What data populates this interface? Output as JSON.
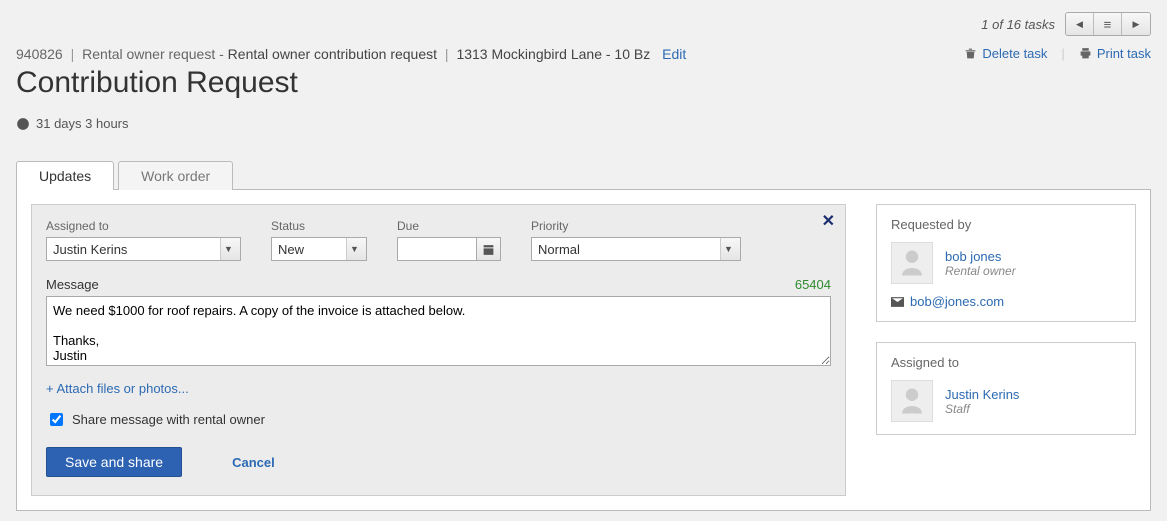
{
  "topbar": {
    "task_count": "1 of 16 tasks"
  },
  "breadcrumb": {
    "id": "940826",
    "type": "Rental owner request",
    "subtype": "Rental owner contribution request",
    "property": "1313 Mockingbird Lane - 10 Bz",
    "edit": "Edit"
  },
  "actions": {
    "delete": "Delete task",
    "print": "Print task"
  },
  "title": "Contribution Request",
  "age": "31 days 3 hours",
  "tabs": {
    "updates": "Updates",
    "work_order": "Work order"
  },
  "form": {
    "assigned_label": "Assigned to",
    "assigned_value": "Justin Kerins",
    "status_label": "Status",
    "status_value": "New",
    "due_label": "Due",
    "due_value": "",
    "priority_label": "Priority",
    "priority_value": "Normal",
    "message_label": "Message",
    "char_count": "65404",
    "message_value": "We need $1000 for roof repairs. A copy of the invoice is attached below.\n\nThanks,\nJustin",
    "attach": "+ Attach files or photos...",
    "share_label": "Share message with rental owner",
    "save": "Save and share",
    "cancel": "Cancel"
  },
  "requested": {
    "heading": "Requested by",
    "name": "bob jones",
    "role": "Rental owner",
    "email": "bob@jones.com"
  },
  "assigned": {
    "heading": "Assigned to",
    "name": "Justin Kerins",
    "role": "Staff"
  }
}
